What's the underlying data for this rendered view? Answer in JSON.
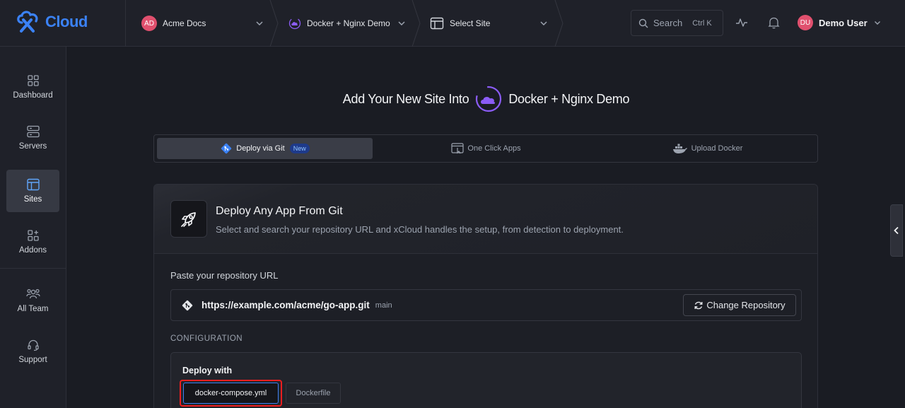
{
  "brand": {
    "name": "Cloud",
    "accent": "#3b82f6"
  },
  "breadcrumbs": {
    "team": {
      "initials": "AD",
      "label": "Acme Docs"
    },
    "server": {
      "label": "Docker + Nginx Demo"
    },
    "site": {
      "label": "Select Site"
    }
  },
  "search": {
    "label": "Search",
    "shortcut": "Ctrl K"
  },
  "user": {
    "initials": "DU",
    "name": "Demo User"
  },
  "sidebar": {
    "items": [
      {
        "label": "Dashboard",
        "icon": "dashboard-icon"
      },
      {
        "label": "Servers",
        "icon": "servers-icon"
      },
      {
        "label": "Sites",
        "icon": "sites-icon",
        "active": true
      },
      {
        "label": "Addons",
        "icon": "addons-icon"
      },
      {
        "label": "All Team",
        "icon": "team-icon"
      },
      {
        "label": "Support",
        "icon": "support-icon"
      }
    ]
  },
  "page": {
    "heading_prefix": "Add Your New Site Into",
    "heading_server": "Docker + Nginx Demo"
  },
  "tabs": [
    {
      "label": "Deploy via Git",
      "badge": "New",
      "active": true
    },
    {
      "label": "One Click Apps"
    },
    {
      "label": "Upload Docker"
    }
  ],
  "card": {
    "title": "Deploy Any App From Git",
    "subtitle": "Select and search your repository URL and xCloud handles the setup, from detection to deployment.",
    "repo_label": "Paste your repository URL",
    "repo_url": "https://example.com/acme/go-app.git",
    "repo_branch": "main",
    "change_repo_label": "Change Repository",
    "config_label": "CONFIGURATION",
    "deploy_with_label": "Deploy with",
    "deploy_options": [
      {
        "label": "docker-compose.yml",
        "selected": true
      },
      {
        "label": "Dockerfile",
        "selected": false
      }
    ]
  }
}
